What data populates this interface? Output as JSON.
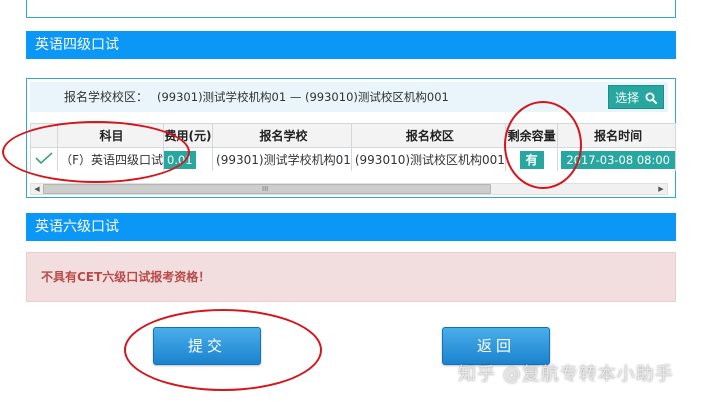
{
  "sections": {
    "cet4": {
      "title": "英语四级口试"
    },
    "cet6": {
      "title": "英语六级口试"
    }
  },
  "school_row": {
    "label": "报名学校校区：",
    "value": "(99301)测试学校机构01 — (993010)测试校区机构001",
    "select_label": "选择"
  },
  "table": {
    "headers": {
      "subject": "科目",
      "fee": "费用(元)",
      "school": "报名学校",
      "campus": "报名校区",
      "capacity": "剩余容量",
      "time": "报名时间"
    },
    "row": {
      "subject": "（F）英语四级口试",
      "fee": "0.01",
      "school": "(99301)测试学校机构01",
      "campus": "(993010)测试校区机构001",
      "capacity": "有",
      "time": "2017-03-08 08:00"
    }
  },
  "scrollbar": {
    "left_arrow": "◀",
    "right_arrow": "▶",
    "grip": "III"
  },
  "alert": {
    "message": "不具有CET六级口试报考资格！"
  },
  "buttons": {
    "submit": "提交",
    "back": "返回"
  },
  "watermark": "知乎 @复航专转本小助手",
  "colors": {
    "header_blue": "#0a97f5",
    "teal": "#27a7a0",
    "alert_bg": "#f2dede",
    "alert_text": "#b94a48",
    "annotation_red": "#d4151b"
  }
}
